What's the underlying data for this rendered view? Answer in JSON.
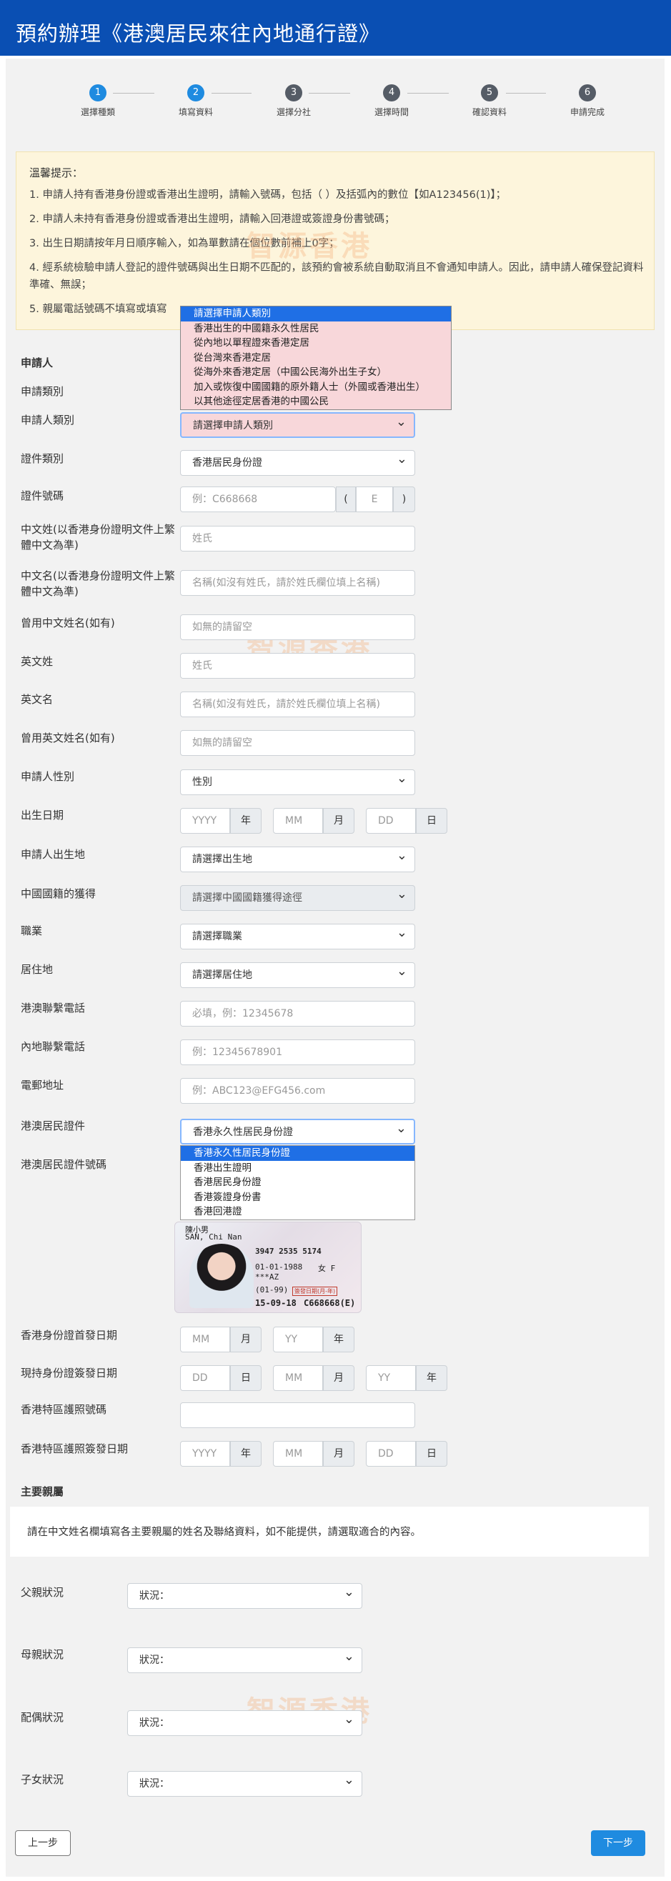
{
  "header": {
    "title": "預約辦理《港澳居民來往內地通行證》"
  },
  "steps": [
    {
      "num": "1",
      "label": "選擇種類",
      "state": "done"
    },
    {
      "num": "2",
      "label": "填寫資料",
      "state": "current"
    },
    {
      "num": "3",
      "label": "選擇分社",
      "state": "todo"
    },
    {
      "num": "4",
      "label": "選擇時間",
      "state": "todo"
    },
    {
      "num": "5",
      "label": "確認資料",
      "state": "todo"
    },
    {
      "num": "6",
      "label": "申請完成",
      "state": "todo"
    }
  ],
  "notice": {
    "title": "溫馨提示：",
    "items": [
      "1. 申請人持有香港身份證或香港出生證明，請輸入號碼，包括（ ）及括弧內的數位【如A123456(1)】；",
      "2. 申請人未持有香港身份證或香港出生證明，請輸入回港證或簽證身份書號碼；",
      "3. 出生日期請按年月日順序輸入，如為單數請在個位數前補上0字；",
      "4. 經系統檢驗申請人登記的證件號碼與出生日期不匹配的，該預約會被系統自動取消且不會通知申請人。因此，請申請人確保登記資料準確、無誤；",
      "5. 親屬電話號碼不填寫或填寫"
    ]
  },
  "watermark": "智源香港",
  "applicant": {
    "section_title": "申請人",
    "category_label": "申請類別",
    "type_label": "申請人類別",
    "type_value": "請選擇申請人類別",
    "type_options": [
      "請選擇申請人類別",
      "香港出生的中國籍永久性居民",
      "從內地以單程證來香港定居",
      "從台灣來香港定居",
      "從海外來香港定居（中國公民海外出生子女）",
      "加入或恢復中國國籍的原外籍人士（外國或香港出生）",
      "以其他途徑定居香港的中國公民"
    ],
    "doc_type_label": "證件類別",
    "doc_type_value": "香港居民身份證",
    "doc_no_label": "證件號碼",
    "doc_no_placeholder": "例：C668668",
    "doc_check_placeholder": "E",
    "paren_open": "(",
    "paren_close": ")",
    "cn_surname_label": "中文姓(以香港身份證明文件上繁體中文為準)",
    "cn_surname_placeholder": "姓氏",
    "cn_name_label": "中文名(以香港身份證明文件上繁體中文為準)",
    "cn_name_placeholder": "名稱(如沒有姓氏，請於姓氏欄位填上名稱)",
    "former_cn_label": "曾用中文姓名(如有)",
    "former_cn_placeholder": "如無的請留空",
    "en_surname_label": "英文姓",
    "en_surname_placeholder": "姓氏",
    "en_name_label": "英文名",
    "en_name_placeholder": "名稱(如沒有姓氏，請於姓氏欄位填上名稱)",
    "former_en_label": "曾用英文姓名(如有)",
    "former_en_placeholder": "如無的請留空",
    "gender_label": "申請人性別",
    "gender_value": "性別",
    "dob_label": "出生日期",
    "dob_year_placeholder": "YYYY",
    "dob_month_placeholder": "MM",
    "dob_day_placeholder": "DD",
    "unit_year": "年",
    "unit_month": "月",
    "unit_day": "日",
    "birthplace_label": "申請人出生地",
    "birthplace_value": "請選擇出生地",
    "nationality_label": "中國國籍的獲得",
    "nationality_value": "請選擇中國國籍獲得途徑",
    "occupation_label": "職業",
    "occupation_value": "請選擇職業",
    "residence_label": "居住地",
    "residence_value": "請選擇居住地",
    "hk_phone_label": "港澳聯繫電話",
    "hk_phone_placeholder": "必填，例：12345678",
    "cn_phone_label": "內地聯繫電話",
    "cn_phone_placeholder": "例：12345678901",
    "email_label": "電郵地址",
    "email_placeholder": "例：ABC123@EFG456.com",
    "resident_doc_label": "港澳居民證件",
    "resident_doc_value": "香港永久性居民身份證",
    "resident_doc_options": [
      "香港永久性居民身份證",
      "香港出生證明",
      "香港居民身份證",
      "香港簽證身份書",
      "香港回港證"
    ],
    "resident_doc_no_label": "港澳居民證件號碼",
    "card_sample": {
      "name_cn": "陳小男",
      "name_en": "SAN, Chi Nan",
      "code": "3947 2535 5174",
      "dob": "01-01-1988",
      "sex": "女 F",
      "symbols": "***AZ",
      "issue": "(01-99)",
      "date": "15-09-18",
      "number": "C668668(E)",
      "stamp": "簽發日期(月-年)"
    },
    "first_issue_label": "香港身份證首發日期",
    "first_issue_month_placeholder": "MM",
    "first_issue_year_placeholder": "YY",
    "current_issue_label": "現持身份證簽發日期",
    "current_issue_day_placeholder": "DD",
    "current_issue_month_placeholder": "MM",
    "current_issue_year_placeholder": "YY",
    "passport_no_label": "香港特區護照號碼",
    "passport_issue_label": "香港特區護照簽發日期",
    "passport_year_placeholder": "YYYY",
    "passport_month_placeholder": "MM",
    "passport_day_placeholder": "DD"
  },
  "relatives": {
    "section_title": "主要親屬",
    "info": "請在中文姓名欄填寫各主要親屬的姓名及聯絡資料，如不能提供，請選取適合的內容。",
    "father_label": "父親狀況",
    "mother_label": "母親狀況",
    "spouse_label": "配偶狀況",
    "children_label": "子女狀況",
    "status_placeholder": "狀況："
  },
  "nav": {
    "prev": "上一步",
    "next": "下一步"
  }
}
